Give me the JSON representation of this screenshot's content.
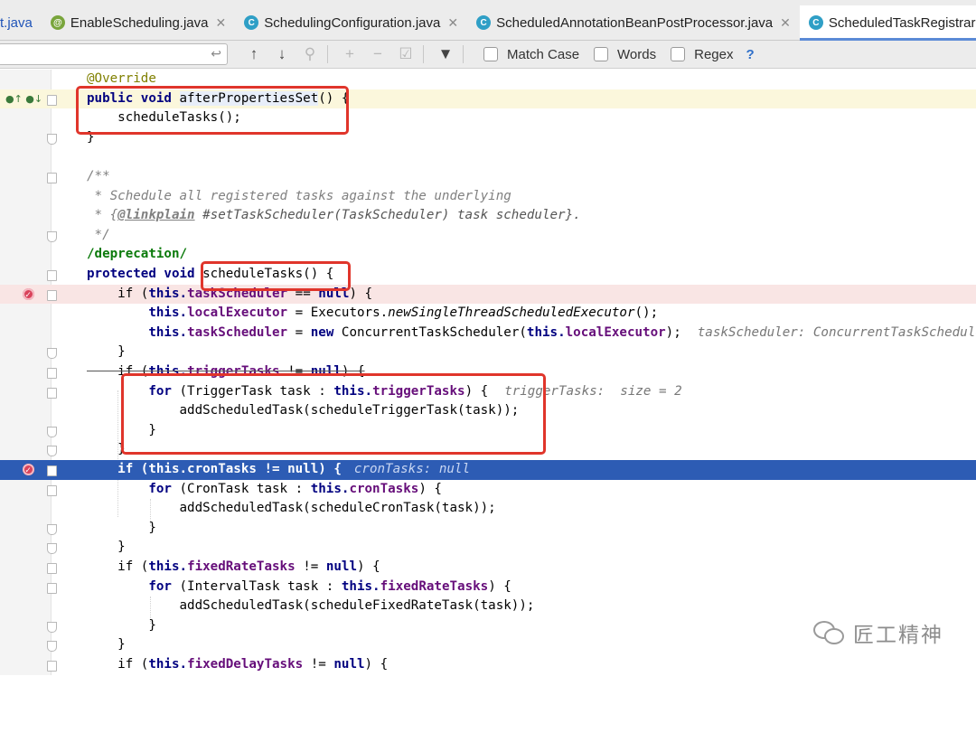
{
  "tabs": [
    {
      "label": "t.java",
      "icon": "none",
      "active": false
    },
    {
      "label": "EnableScheduling.java",
      "icon": "@",
      "active": false
    },
    {
      "label": "SchedulingConfiguration.java",
      "icon": "C",
      "active": false
    },
    {
      "label": "ScheduledAnnotationBeanPostProcessor.java",
      "icon": "C",
      "active": false
    },
    {
      "label": "ScheduledTaskRegistrar.java",
      "icon": "C",
      "active": true
    }
  ],
  "find": {
    "match_case": "Match Case",
    "words": "Words",
    "regex": "Regex",
    "help": "?"
  },
  "code": {
    "l1": "@Override",
    "l2a": "public void ",
    "l2b": "afterPropertiesSet",
    "l2c": "() {",
    "l3": "    scheduleTasks();",
    "l4": "}",
    "l6": "/**",
    "l7": " * Schedule all registered tasks against the underlying",
    "l8a": " * {",
    "l8b": "@linkplain",
    "l8c": " #setTaskScheduler(TaskScheduler) task scheduler}.",
    "l9": " */",
    "l10": "/deprecation/",
    "l11a": "protected void ",
    "l11b": "scheduleTasks() {",
    "l12a": "    if (",
    "l12b": "this.",
    "l12c": "taskScheduler",
    "l12d": " == ",
    "l12e": "null",
    "l12f": ") {",
    "l13a": "        ",
    "l13b": "this.",
    "l13c": "localExecutor",
    "l13d": " = Executors.",
    "l13e": "newSingleThreadScheduledExecutor",
    "l13f": "();",
    "l14a": "        ",
    "l14b": "this.",
    "l14c": "taskScheduler",
    "l14d": " = ",
    "l14e": "new",
    "l14f": " ConcurrentTaskScheduler(",
    "l14g": "this.",
    "l14h": "localExecutor",
    "l14i": ");",
    "l14hint": "taskScheduler: ConcurrentTaskScheduler@",
    "l15": "    }",
    "l16a": "    if (",
    "l16b": "this.",
    "l16c": "triggerTasks",
    "l16d": " != ",
    "l16e": "null",
    "l16f": ") {",
    "l17a": "        for",
    "l17b": " (TriggerTask task : ",
    "l17c": "this.",
    "l17d": "triggerTasks",
    "l17e": ") {",
    "l17hint": "triggerTasks:  size = 2",
    "l18": "            addScheduledTask(scheduleTriggerTask(task));",
    "l19": "        }",
    "l20": "    }",
    "l21a": "    if (this.cronTasks != null) {",
    "l21hint": "cronTasks: null",
    "l22a": "        for",
    "l22b": " (CronTask task : ",
    "l22c": "this.",
    "l22d": "cronTasks",
    "l22e": ") {",
    "l23": "            addScheduledTask(scheduleCronTask(task));",
    "l24": "        }",
    "l25": "    }",
    "l26a": "    if (",
    "l26b": "this.",
    "l26c": "fixedRateTasks",
    "l26d": " != ",
    "l26e": "null",
    "l26f": ") {",
    "l27a": "        for",
    "l27b": " (IntervalTask task : ",
    "l27c": "this.",
    "l27d": "fixedRateTasks",
    "l27e": ") {",
    "l28": "            addScheduledTask(scheduleFixedRateTask(task));",
    "l29": "        }",
    "l30": "    }",
    "l31a": "    if (",
    "l31b": "this.",
    "l31c": "fixedDelayTasks",
    "l31d": " != ",
    "l31e": "null",
    "l31f": ") {"
  },
  "watermark": "匠工精神",
  "colors": {
    "keyword": "#000080",
    "field": "#660e7a",
    "annotation": "#808000",
    "comment": "#808080",
    "execution_line": "#2d5cb4",
    "breakpoint": "#d9435b",
    "annotation_box": "#e0352b"
  }
}
